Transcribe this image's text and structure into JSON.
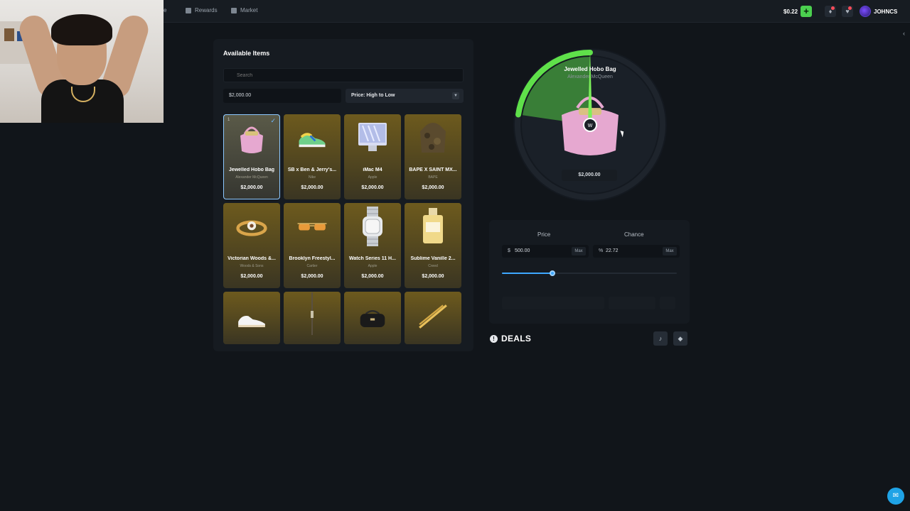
{
  "topbar": {
    "nav_cut": "e",
    "nav": [
      {
        "label": "Rewards",
        "icon": "gift-icon"
      },
      {
        "label": "Market",
        "icon": "cart-icon"
      }
    ],
    "balance": "$0.22",
    "deposit_label": "+",
    "username": "JOHNCS",
    "accent": "#4bd04f"
  },
  "panel": {
    "title": "Available Items",
    "search_placeholder": "Search",
    "price_filter": "$2,000.00",
    "sort_label": "Price: High to Low",
    "items": [
      {
        "name": "Jewelled Hobo Bag",
        "brand": "Alexander McQueen",
        "price": "$2,000.00",
        "selected": true,
        "qty": "1"
      },
      {
        "name": "SB x Ben & Jerry's...",
        "brand": "Nike",
        "price": "$2,000.00"
      },
      {
        "name": "iMac M4",
        "brand": "Apple",
        "price": "$2,000.00"
      },
      {
        "name": "BAPE X SAINT MX...",
        "brand": "BAPE",
        "price": "$2,000.00"
      },
      {
        "name": "Victorian Woods &...",
        "brand": "Woods & Sons",
        "price": "$2,000.00"
      },
      {
        "name": "Brooklyn Freestyl...",
        "brand": "Cartier",
        "price": "$2,000.00"
      },
      {
        "name": "Watch Series 11 H...",
        "brand": "Apple",
        "price": "$2,000.00"
      },
      {
        "name": "Sublime Vanille 2...",
        "brand": "Creed",
        "price": "$2,000.00"
      }
    ]
  },
  "wheel": {
    "item_name": "Jewelled Hobo Bag",
    "item_brand": "Alexander McQueen",
    "item_price": "$2,000.00",
    "win_fraction": 0.2272,
    "win_color": "#4bd04f"
  },
  "controls": {
    "price_label": "Price",
    "chance_label": "Chance",
    "price_prefix": "$",
    "price_value": "500.00",
    "chance_prefix": "%",
    "chance_value": "22.72",
    "max_label": "Max",
    "slider_fraction": 0.29
  },
  "deals": {
    "title": "DEALS"
  }
}
